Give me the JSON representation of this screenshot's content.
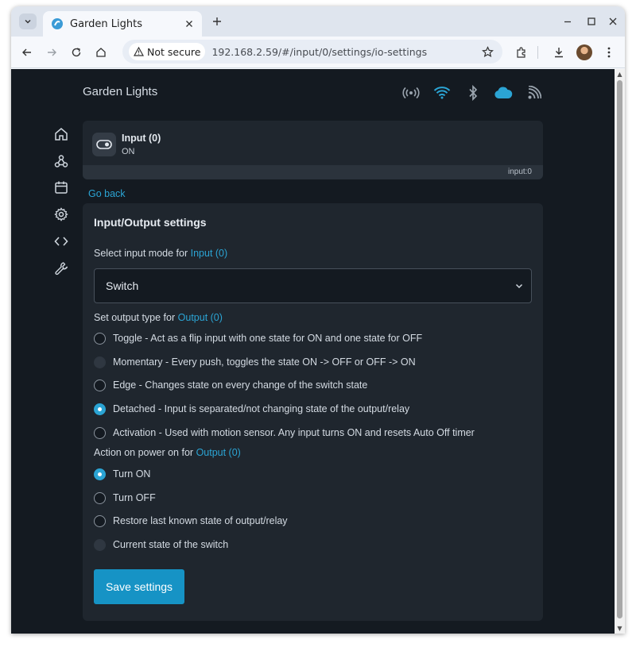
{
  "browser": {
    "tab_title": "Garden Lights",
    "security_label": "Not secure",
    "url": "192.168.2.59/#/input/0/settings/io-settings"
  },
  "header": {
    "title": "Garden Lights",
    "status_icons": [
      "broadcast-icon",
      "wifi-icon",
      "bluetooth-icon",
      "cloud-icon",
      "rss-icon"
    ]
  },
  "sidebar": {
    "items": [
      "home-icon",
      "webhook-icon",
      "calendar-icon",
      "gear-icon",
      "code-icon",
      "wrench-icon"
    ]
  },
  "input_card": {
    "name": "Input (0)",
    "state": "ON",
    "id_label": "input:0"
  },
  "go_back": "Go back",
  "settings": {
    "title": "Input/Output settings",
    "mode_label_prefix": "Select input mode for",
    "mode_label_link": "Input (0)",
    "mode_value": "Switch",
    "output_type_prefix": "Set output type for",
    "output_type_link": "Output (0)",
    "output_types": [
      {
        "label": "Toggle - Act as a flip input with one state for ON and one state for OFF",
        "state": "unchecked"
      },
      {
        "label": "Momentary - Every push, toggles the state ON -> OFF or OFF -> ON",
        "state": "disabled"
      },
      {
        "label": "Edge - Changes state on every change of the switch state",
        "state": "unchecked"
      },
      {
        "label": "Detached - Input is separated/not changing state of the output/relay",
        "state": "checked"
      },
      {
        "label": "Activation - Used with motion sensor. Any input turns ON and resets Auto Off timer",
        "state": "unchecked"
      }
    ],
    "power_on_prefix": "Action on power on for",
    "power_on_link": "Output (0)",
    "power_on_options": [
      {
        "label": "Turn ON",
        "state": "checked"
      },
      {
        "label": "Turn OFF",
        "state": "unchecked"
      },
      {
        "label": "Restore last known state of output/relay",
        "state": "unchecked"
      },
      {
        "label": "Current state of the switch",
        "state": "disabled"
      }
    ],
    "save_label": "Save settings"
  },
  "colors": {
    "accent": "#2ba4d4",
    "page_bg": "#141a21",
    "card_bg": "#1f262e"
  }
}
